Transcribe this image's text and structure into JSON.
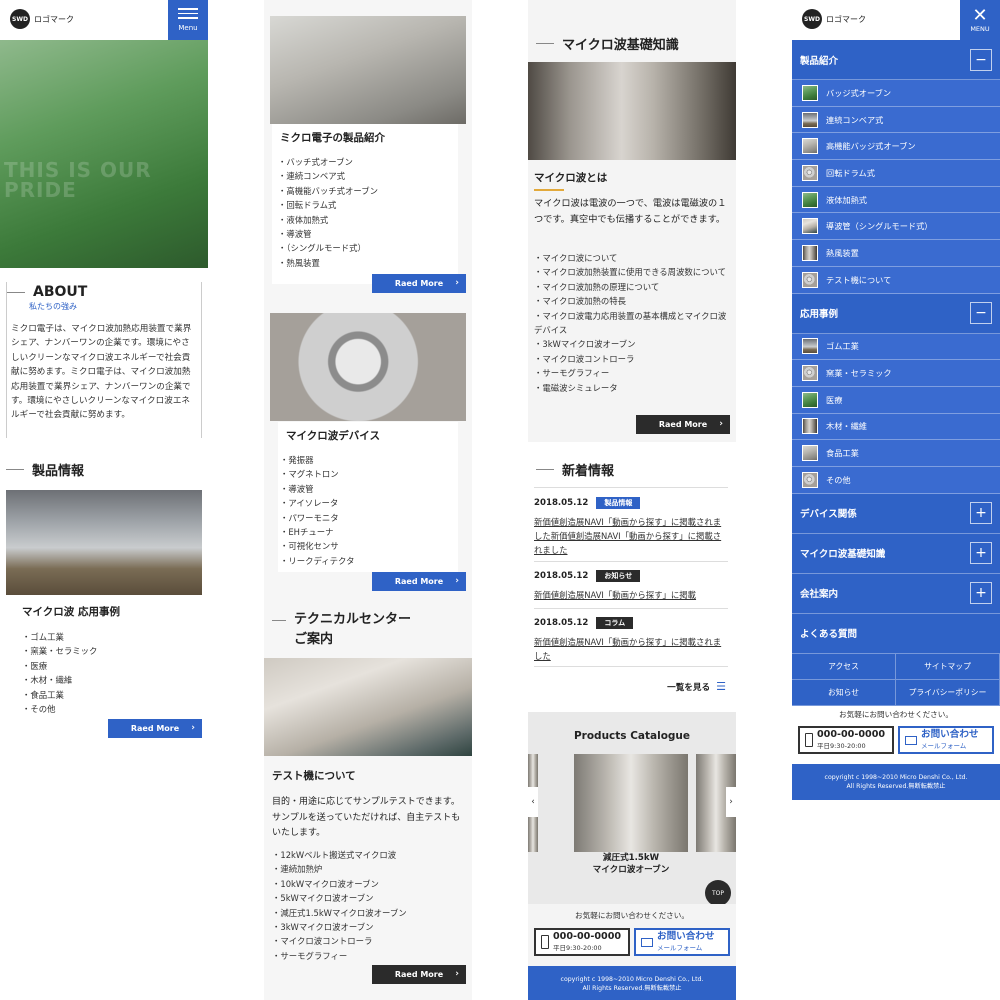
{
  "header": {
    "logo_mark": "SWD",
    "logo_text": "ロゴマーク",
    "menu_label": "Menu",
    "menu_label_upper": "MENU"
  },
  "hero": {
    "overlay_text": "THIS IS OUR PRIDE"
  },
  "about": {
    "title": "ABOUT",
    "subtitle": "私たちの強み",
    "body": "ミクロ電子は、マイクロ波加熱応用装置で業界シェア、ナンバーワンの企業です。環境にやさしいクリーンなマイクロ波エネルギーで社会貢献に努めます。ミクロ電子は、マイクロ波加熱応用装置で業界シェア、ナンバーワンの企業です。環境にやさしいクリーンなマイクロ波エネルギーで社会貢献に努めます。"
  },
  "products_section": {
    "title": "製品情報"
  },
  "read_more_label": "Raed More",
  "cards": {
    "applications": {
      "title": "マイクロ波 応用事例",
      "items": [
        "ゴム工業",
        "窯業・セラミック",
        "医療",
        "木材・繊維",
        "食品工業",
        "その他"
      ]
    },
    "products": {
      "title": "ミクロ電子の製品紹介",
      "items": [
        "バッチ式オーブン",
        "連続コンベア式",
        "高機能バッチ式オーブン",
        "回転ドラム式",
        "液体加熱式",
        "導波管",
        "（シングルモード式）",
        "熱風装置"
      ]
    },
    "devices": {
      "title": "マイクロ波デバイス",
      "items": [
        "発振器",
        "マグネトロン",
        "導波管",
        "アイソレータ",
        "パワーモニタ",
        "EHチューナ",
        "可視化センサ",
        "リークディテクタ"
      ]
    }
  },
  "technical": {
    "title_line1": "テクニカルセンター",
    "title_line2": "ご案内",
    "card_title": "テスト機について",
    "intro": "目的・用途に応じてサンプルテストできます。サンプルを送っていただければ、自主テストもいたします。",
    "items": [
      "12kWベルト搬送式マイクロ波",
      "連続加熱炉",
      "10kWマイクロ波オーブン",
      "5kWマイクロ波オーブン",
      "減圧式1.5kWマイクロ波オーブン",
      "3kWマイクロ波オーブン",
      "マイクロ波コントローラ",
      "サーモグラフィー"
    ]
  },
  "basics": {
    "title": "マイクロ波基礎知識",
    "sub_title": "マイクロ波とは",
    "intro": "マイクロ波は電波の一つで、電波は電磁波の１つです。真空中でも伝播することができます。",
    "items": [
      "マイクロ波について",
      "マイクロ波加熱装置に使用できる周波数について",
      "マイクロ波加熱の原理について",
      "マイクロ波加熱の特長",
      "マイクロ波電力応用装置の基本構成とマイクロ波デバイス",
      "3kWマイクロ波オーブン",
      "マイクロ波コントローラ",
      "サーモグラフィー",
      "電磁波シミュレータ"
    ]
  },
  "news": {
    "title": "新着情報",
    "items": [
      {
        "date": "2018.05.12",
        "tag": "製品情報",
        "tag_color": "#2f62c6",
        "text": "新価値創造展NAVI「動画から探す」に掲載されました新価値創造展NAVI「動画から探す」に掲載されました"
      },
      {
        "date": "2018.05.12",
        "tag": "お知らせ",
        "tag_color": "#2b2b2b",
        "text": "新価値創造展NAVI「動画から探す」に掲載"
      },
      {
        "date": "2018.05.12",
        "tag": "コラム",
        "tag_color": "#2b2b2b",
        "text": "新価値創造展NAVI「動画から探す」に掲載されました"
      }
    ],
    "list_link": "一覧を見る"
  },
  "catalogue": {
    "title": "Products Catalogue",
    "item_line1": "減圧式1.5kW",
    "item_line2": "マイクロ波オーブン",
    "top_label": "TOP"
  },
  "contact": {
    "lead": "お気軽にお問い合わせください。",
    "phone": "000-00-0000",
    "hours": "平日9:30-20:00",
    "mail_label": "お問い合わせ",
    "mail_sub": "メールフォーム"
  },
  "footer": {
    "line1": "copyright c 1998~2010 Micro Denshi Co., Ltd.",
    "line2": "All Rights Reserved.無断転載禁止"
  },
  "nav": {
    "products_head": "製品紹介",
    "product_items": [
      "バッジ式オーブン",
      "連続コンベア式",
      "高機能バッジ式オーブン",
      "回転ドラム式",
      "液体加熱式",
      "導波管（シングルモード式）",
      "熱風装置",
      "テスト機について"
    ],
    "apps_head": "応用事例",
    "app_items": [
      "ゴム工業",
      "窯業・セラミック",
      "医療",
      "木材・繊維",
      "食品工業",
      "その他"
    ],
    "devices_head": "デバイス関係",
    "basics_head": "マイクロ波基礎知識",
    "company_head": "会社案内",
    "faq_head": "よくある質問",
    "grid": [
      "アクセス",
      "サイトマップ",
      "お知らせ",
      "プライバシーポリシー"
    ]
  }
}
